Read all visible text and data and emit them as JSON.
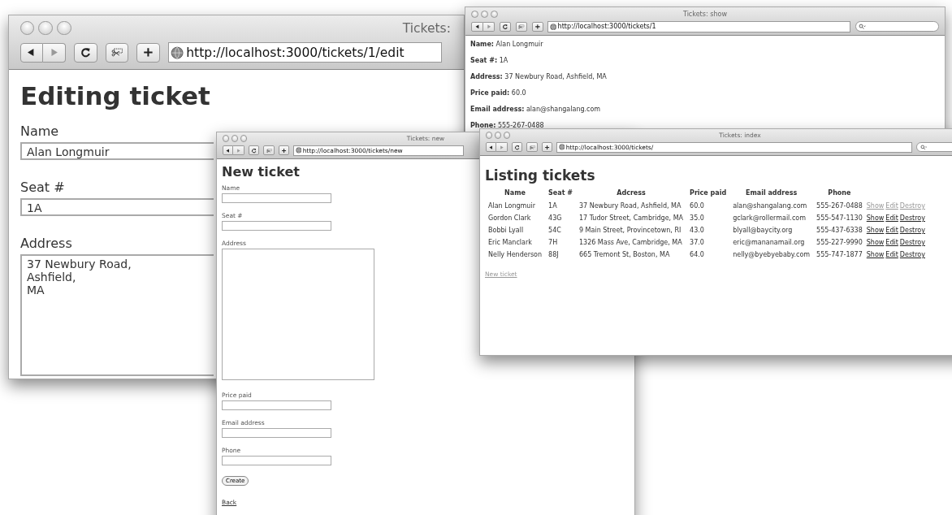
{
  "windows": [
    {
      "kind": "edit",
      "title": "Tickets:",
      "url": "http://localhost:3000/tickets/1/edit",
      "search_field": false,
      "heading": "Editing ticket",
      "fields": [
        {
          "kind": "text",
          "label": "Name",
          "value": "Alan Longmuir"
        },
        {
          "kind": "text",
          "label": "Seat #",
          "value": "1A"
        },
        {
          "kind": "textarea",
          "label": "Address",
          "value": "37 Newbury Road,\nAshfield,\nMA"
        }
      ]
    },
    {
      "kind": "show",
      "title": "Tickets: show",
      "url": "http://localhost:3000/tickets/1",
      "search_field": true,
      "lines": [
        {
          "label": "Name:",
          "value": "Alan Longmuir"
        },
        {
          "label": "Seat #:",
          "value": "1A"
        },
        {
          "label": "Address:",
          "value": "37 Newbury Road, Ashfield, MA"
        },
        {
          "label": "Price paid:",
          "value": "60.0"
        },
        {
          "label": "Email address:",
          "value": "alan@shangalang.com"
        },
        {
          "label": "Phone:",
          "value": "555-267-0488"
        }
      ]
    },
    {
      "kind": "new",
      "title": "Tickets: new",
      "url": "http://localhost:3000/tickets/new",
      "search_field": false,
      "heading": "New ticket",
      "fields": [
        {
          "kind": "text",
          "label": "Name"
        },
        {
          "kind": "text",
          "label": "Seat #"
        },
        {
          "kind": "textarea",
          "label": "Address"
        },
        {
          "kind": "text",
          "label": "Price paid"
        },
        {
          "kind": "text",
          "label": "Email address"
        },
        {
          "kind": "text",
          "label": "Phone"
        }
      ],
      "submit": "Create",
      "back_link": "Back"
    },
    {
      "kind": "index",
      "title": "Tickets: index",
      "url": "http://localhost:3000/tickets/",
      "search_field": true,
      "heading": "Listing tickets",
      "columns": [
        "Name",
        "Seat #",
        "Adcress",
        "Price paid",
        "Email address",
        "Phone"
      ],
      "rows": [
        {
          "cells": [
            "Alan Longmuir",
            "1A",
            "37 Newbury Road, Ashfield, MA",
            "60.0",
            "alan@shangalang.com",
            "555-267-0488"
          ],
          "actions": [
            {
              "label": "Show",
              "visited": true
            },
            {
              "label": "Edit",
              "visited": true
            },
            {
              "label": "Destroy",
              "visited": true
            }
          ]
        },
        {
          "cells": [
            "Gordon Clark",
            "43G",
            "17 Tudor Street, Cambridge, MA",
            "35.0",
            "gclark@rollermail.com",
            "555-547-1130"
          ],
          "actions": [
            {
              "label": "Show",
              "visited": false
            },
            {
              "label": "Edit",
              "visited": false
            },
            {
              "label": "Destroy",
              "visited": false
            }
          ]
        },
        {
          "cells": [
            "Bobbi Lyall",
            "54C",
            "9 Main Street, Provincetown, RI",
            "43.0",
            "blyall@baycity.org",
            "555-437-6338"
          ],
          "actions": [
            {
              "label": "Show",
              "visited": false
            },
            {
              "label": "Edit",
              "visited": false
            },
            {
              "label": "Destroy",
              "visited": false
            }
          ]
        },
        {
          "cells": [
            "Eric Manclark",
            "7H",
            "1326 Mass Ave, Cambridge, MA",
            "37.0",
            "eric@mananamail.org",
            "555-227-9990"
          ],
          "actions": [
            {
              "label": "Show",
              "visited": false
            },
            {
              "label": "Edit",
              "visited": false
            },
            {
              "label": "Destroy",
              "visited": false
            }
          ]
        },
        {
          "cells": [
            "Nelly Henderson",
            "88J",
            "665 Tremont St, Boston, MA",
            "64.0",
            "nelly@byebyebaby.com",
            "555-747-1877"
          ],
          "actions": [
            {
              "label": "Show",
              "visited": false
            },
            {
              "label": "Edit",
              "visited": false
            },
            {
              "label": "Destroy",
              "visited": false
            }
          ]
        }
      ],
      "new_link": {
        "label": "New ticket",
        "visited": true
      }
    }
  ]
}
